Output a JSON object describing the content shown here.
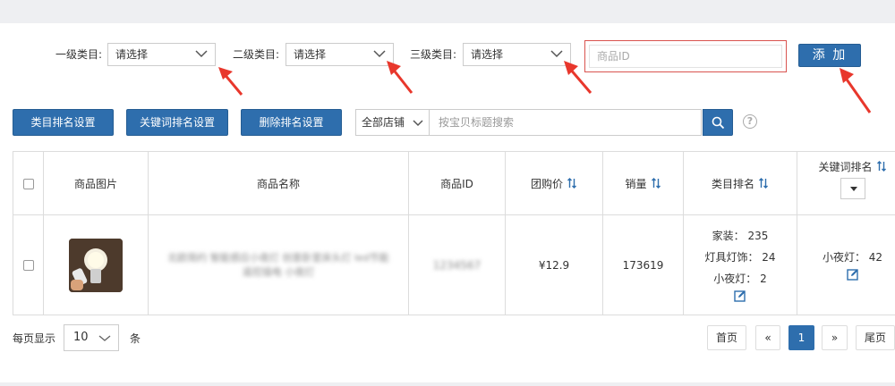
{
  "filters": {
    "level1_label": "一级类目:",
    "level1_value": "请选择",
    "level2_label": "二级类目:",
    "level2_value": "请选择",
    "level3_label": "三级类目:",
    "level3_value": "请选择",
    "product_id_placeholder": "商品ID",
    "add_button": "添 加"
  },
  "toolbar": {
    "category_rank_button": "类目排名设置",
    "keyword_rank_button": "关键词排名设置",
    "delete_rank_button": "删除排名设置",
    "store_select": "全部店铺",
    "search_placeholder": "按宝贝标题搜索",
    "help": "?"
  },
  "table": {
    "headers": {
      "image": "商品图片",
      "name": "商品名称",
      "id": "商品ID",
      "price": "团购价",
      "sales": "销量",
      "category_rank": "类目排名",
      "keyword_rank": "关键词排名"
    },
    "rows": [
      {
        "name_blurred": "北欧简约 智能感应小夜灯 创意卧室床头灯 led节能遥控插电 小夜灯",
        "id_blurred": "1234567",
        "price": "¥12.9",
        "sales": "173619",
        "category_ranks": [
          "家装： 235",
          "灯具灯饰： 24",
          "小夜灯： 2"
        ],
        "keyword_ranks": [
          "小夜灯： 42"
        ]
      }
    ]
  },
  "pagination": {
    "per_page_label": "每页显示",
    "per_page_value": "10",
    "per_page_unit": "条",
    "first": "首页",
    "prev": "«",
    "current": "1",
    "next": "»",
    "last": "尾页"
  },
  "colors": {
    "primary": "#2e6ead",
    "arrow": "#e8372c",
    "highlight_border": "#d9534f"
  }
}
